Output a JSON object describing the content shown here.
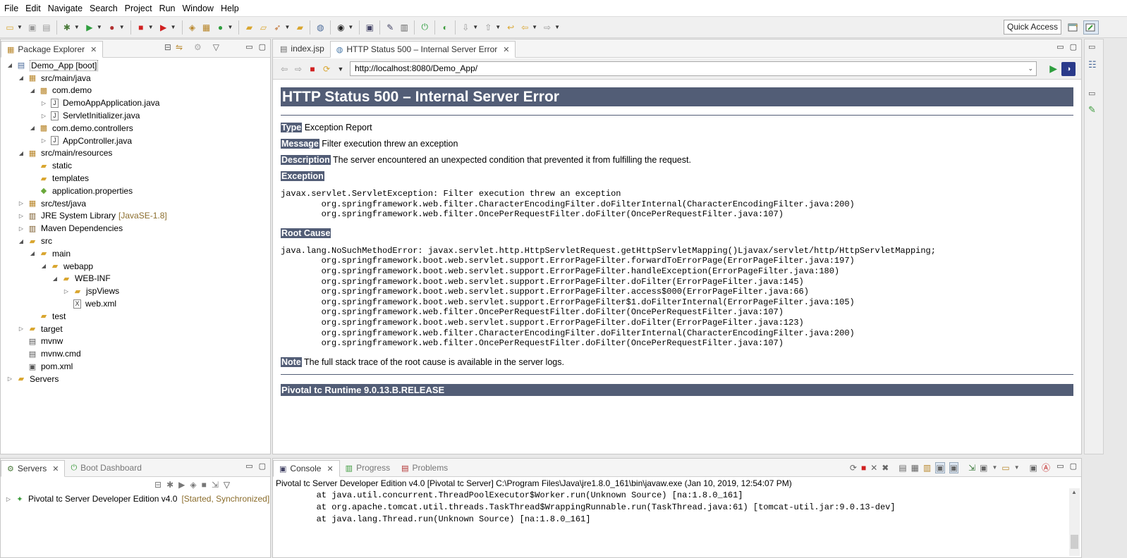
{
  "menu": [
    "File",
    "Edit",
    "Navigate",
    "Search",
    "Project",
    "Run",
    "Window",
    "Help"
  ],
  "toolbar": {
    "quick_access": "Quick Access"
  },
  "package_explorer": {
    "tab_label": "Package Explorer",
    "items": [
      {
        "label": "Demo_App [boot]",
        "depth": 0,
        "twisty": "open",
        "icon": "project-icon"
      },
      {
        "label": "src/main/java",
        "depth": 1,
        "twisty": "open",
        "icon": "source-folder-icon"
      },
      {
        "label": "com.demo",
        "depth": 2,
        "twisty": "open",
        "icon": "package-icon"
      },
      {
        "label": "DemoAppApplication.java",
        "depth": 3,
        "twisty": "closed",
        "icon": "java-file-icon"
      },
      {
        "label": "ServletInitializer.java",
        "depth": 3,
        "twisty": "closed",
        "icon": "java-file-icon"
      },
      {
        "label": "com.demo.controllers",
        "depth": 2,
        "twisty": "open",
        "icon": "package-icon"
      },
      {
        "label": "AppController.java",
        "depth": 3,
        "twisty": "closed",
        "icon": "java-file-icon"
      },
      {
        "label": "src/main/resources",
        "depth": 1,
        "twisty": "open",
        "icon": "source-folder-icon"
      },
      {
        "label": "static",
        "depth": 2,
        "twisty": "none",
        "icon": "folder-icon"
      },
      {
        "label": "templates",
        "depth": 2,
        "twisty": "none",
        "icon": "folder-icon"
      },
      {
        "label": "application.properties",
        "depth": 2,
        "twisty": "none",
        "icon": "properties-file-icon"
      },
      {
        "label": "src/test/java",
        "depth": 1,
        "twisty": "closed",
        "icon": "source-folder-icon"
      },
      {
        "label": "JRE System Library",
        "decoration": "[JavaSE-1.8]",
        "depth": 1,
        "twisty": "closed",
        "icon": "library-icon"
      },
      {
        "label": "Maven Dependencies",
        "depth": 1,
        "twisty": "closed",
        "icon": "library-icon"
      },
      {
        "label": "src",
        "depth": 1,
        "twisty": "open",
        "icon": "folder-icon"
      },
      {
        "label": "main",
        "depth": 2,
        "twisty": "open",
        "icon": "folder-icon"
      },
      {
        "label": "webapp",
        "depth": 3,
        "twisty": "open",
        "icon": "folder-icon"
      },
      {
        "label": "WEB-INF",
        "depth": 4,
        "twisty": "open",
        "icon": "folder-icon"
      },
      {
        "label": "jspViews",
        "depth": 5,
        "twisty": "closed",
        "icon": "folder-icon"
      },
      {
        "label": "web.xml",
        "depth": 5,
        "twisty": "none",
        "icon": "xml-file-icon"
      },
      {
        "label": "test",
        "depth": 2,
        "twisty": "none",
        "icon": "folder-icon"
      },
      {
        "label": "target",
        "depth": 1,
        "twisty": "closed",
        "icon": "folder-icon"
      },
      {
        "label": "mvnw",
        "depth": 1,
        "twisty": "none",
        "icon": "text-file-icon"
      },
      {
        "label": "mvnw.cmd",
        "depth": 1,
        "twisty": "none",
        "icon": "text-file-icon"
      },
      {
        "label": "pom.xml",
        "depth": 1,
        "twisty": "none",
        "icon": "maven-pom-icon"
      },
      {
        "label": "Servers",
        "depth": 0,
        "twisty": "closed",
        "icon": "folder-icon"
      }
    ]
  },
  "editor": {
    "tabs": [
      {
        "label": "index.jsp",
        "active": false
      },
      {
        "label": "HTTP Status 500 – Internal Server Error",
        "active": true
      }
    ],
    "url": "http://localhost:8080/Demo_App/"
  },
  "error_page": {
    "title": "HTTP Status 500 – Internal Server Error",
    "type_label": "Type",
    "type_value": " Exception Report",
    "message_label": "Message",
    "message_value": " Filter execution threw an exception",
    "description_label": "Description",
    "description_value": " The server encountered an unexpected condition that prevented it from fulfilling the request.",
    "exception_label": "Exception",
    "exception_trace": "javax.servlet.ServletException: Filter execution threw an exception\n\torg.springframework.web.filter.CharacterEncodingFilter.doFilterInternal(CharacterEncodingFilter.java:200)\n\torg.springframework.web.filter.OncePerRequestFilter.doFilter(OncePerRequestFilter.java:107)",
    "root_cause_label": "Root Cause",
    "root_cause_trace": "java.lang.NoSuchMethodError: javax.servlet.http.HttpServletRequest.getHttpServletMapping()Ljavax/servlet/http/HttpServletMapping;\n\torg.springframework.boot.web.servlet.support.ErrorPageFilter.forwardToErrorPage(ErrorPageFilter.java:197)\n\torg.springframework.boot.web.servlet.support.ErrorPageFilter.handleException(ErrorPageFilter.java:180)\n\torg.springframework.boot.web.servlet.support.ErrorPageFilter.doFilter(ErrorPageFilter.java:145)\n\torg.springframework.boot.web.servlet.support.ErrorPageFilter.access$000(ErrorPageFilter.java:66)\n\torg.springframework.boot.web.servlet.support.ErrorPageFilter$1.doFilterInternal(ErrorPageFilter.java:105)\n\torg.springframework.web.filter.OncePerRequestFilter.doFilter(OncePerRequestFilter.java:107)\n\torg.springframework.boot.web.servlet.support.ErrorPageFilter.doFilter(ErrorPageFilter.java:123)\n\torg.springframework.web.filter.CharacterEncodingFilter.doFilterInternal(CharacterEncodingFilter.java:200)\n\torg.springframework.web.filter.OncePerRequestFilter.doFilter(OncePerRequestFilter.java:107)",
    "note_label": "Note",
    "note_value": " The full stack trace of the root cause is available in the server logs.",
    "footer": "Pivotal tc Runtime 9.0.13.B.RELEASE"
  },
  "servers_panel": {
    "tabs": [
      {
        "label": "Servers",
        "active": true
      },
      {
        "label": "Boot Dashboard",
        "active": false
      }
    ],
    "server_name": "Pivotal tc Server Developer Edition v4.0",
    "server_status": "[Started, Synchronized]"
  },
  "console": {
    "tabs": [
      {
        "label": "Console",
        "active": true
      },
      {
        "label": "Progress",
        "active": false
      },
      {
        "label": "Problems",
        "active": false
      }
    ],
    "header": "Pivotal tc Server Developer Edition v4.0 [Pivotal tc Server] C:\\Program Files\\Java\\jre1.8.0_161\\bin\\javaw.exe (Jan 10, 2019, 12:54:07 PM)",
    "lines": "\tat java.util.concurrent.ThreadPoolExecutor$Worker.run(Unknown Source) [na:1.8.0_161]\n\tat org.apache.tomcat.util.threads.TaskThread$WrappingRunnable.run(TaskThread.java:61) [tomcat-util.jar:9.0.13-dev]\n\tat java.lang.Thread.run(Unknown Source) [na:1.8.0_161]"
  },
  "colors": {
    "error_header": "#525d76"
  }
}
